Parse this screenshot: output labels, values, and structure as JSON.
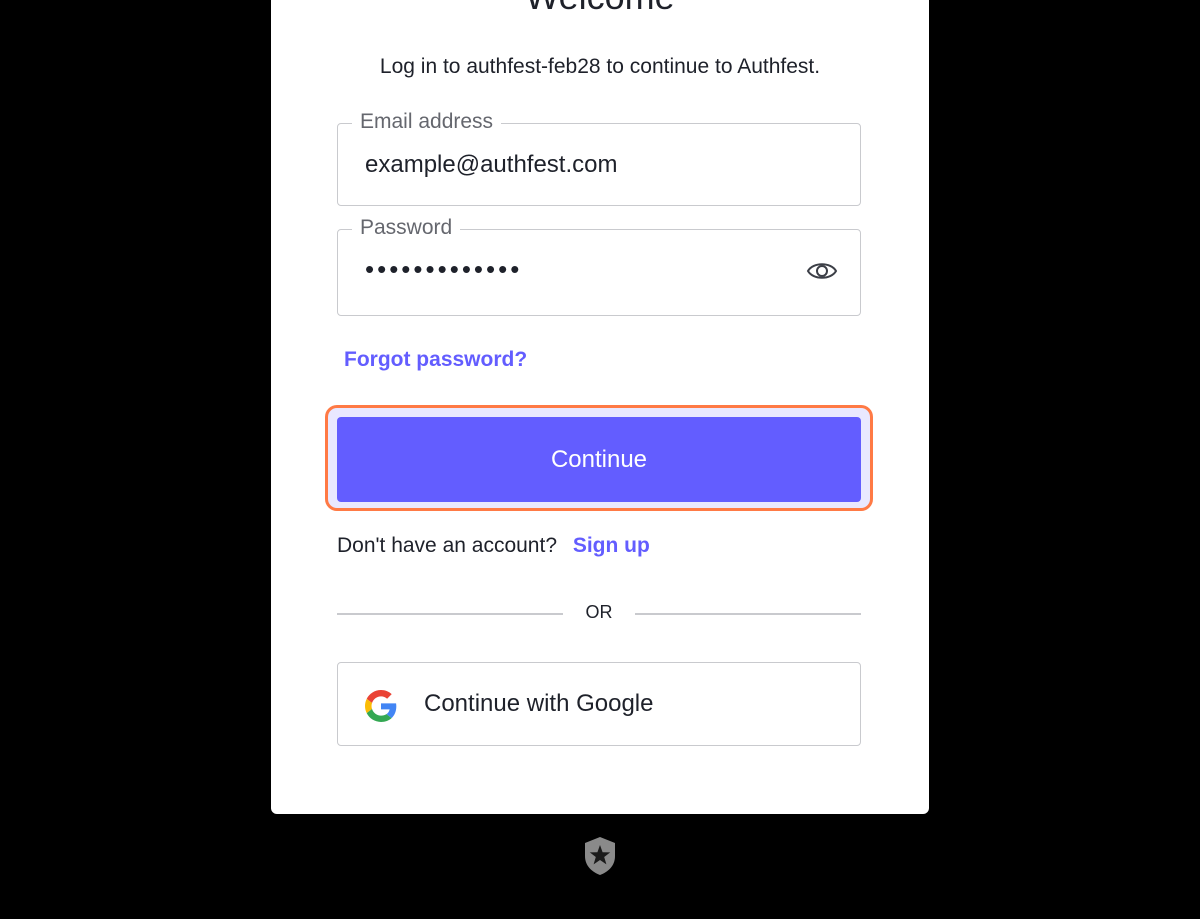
{
  "card": {
    "title": "Welcome",
    "subtitle": "Log in to authfest-feb28 to continue to Authfest."
  },
  "email": {
    "label": "Email address",
    "value": "example@authfest.com"
  },
  "password": {
    "label": "Password",
    "masked_value": "•••••••••••••",
    "toggle_icon": "eye-icon"
  },
  "links": {
    "forgot_password": "Forgot password?"
  },
  "actions": {
    "continue_label": "Continue",
    "signup_prompt": "Don't have an account?",
    "signup_link": "Sign up",
    "divider_text": "OR",
    "google_label": "Continue with Google",
    "google_icon": "google-logo-icon"
  },
  "footer": {
    "logo_icon": "auth0-shield-icon"
  },
  "colors": {
    "background": "#000000",
    "card": "#ffffff",
    "accent": "#635dff",
    "focus_ring": "#ff7a45",
    "border": "#c9cace",
    "text": "#1e212a"
  }
}
